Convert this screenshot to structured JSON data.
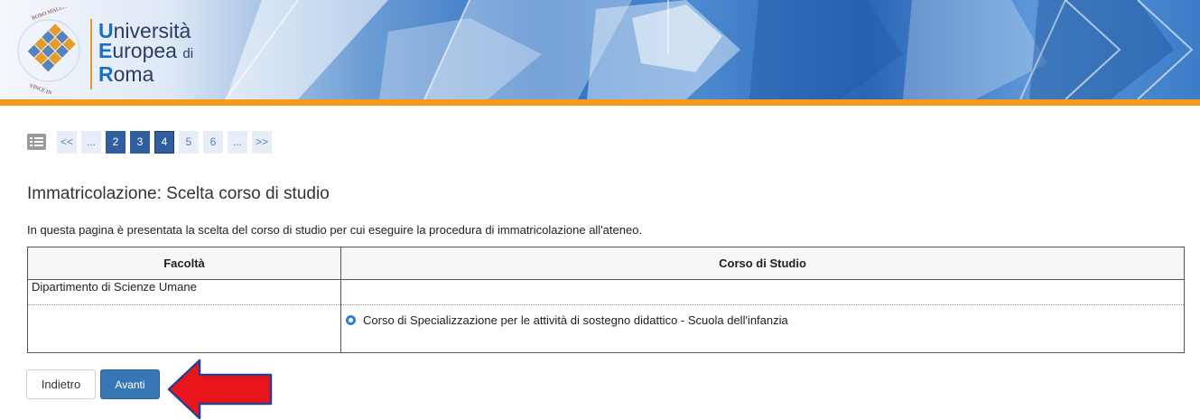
{
  "header": {
    "logo": {
      "line1_cap": "U",
      "line1_rest": "niversità",
      "line2_cap": "E",
      "line2_rest": "uropea",
      "line2_di": "di",
      "line3_cap": "R",
      "line3_rest": "oma",
      "seal_text": "VINCE IN BONO MALUM"
    },
    "colors": {
      "accent_bar": "#f39a1b",
      "brand_blue": "#2f5f9d"
    }
  },
  "pager": {
    "list_icon": "list-icon",
    "items": [
      {
        "label": "<<",
        "state": "light"
      },
      {
        "label": "...",
        "state": "light"
      },
      {
        "label": "2",
        "state": "dark"
      },
      {
        "label": "3",
        "state": "dark"
      },
      {
        "label": "4",
        "state": "current"
      },
      {
        "label": "5",
        "state": "light"
      },
      {
        "label": "6",
        "state": "light"
      },
      {
        "label": "...",
        "state": "light"
      },
      {
        "label": ">>",
        "state": "light"
      }
    ]
  },
  "page": {
    "title": "Immatricolazione: Scelta corso di studio",
    "intro": "In questa pagina è presentata la scelta del corso di studio per cui eseguire la procedura di immatricolazione all'ateneo."
  },
  "table": {
    "headers": [
      "Facoltà",
      "Corso di Studio"
    ],
    "department": "Dipartimento di Scienze Umane",
    "course_option": "Corso di Specializzazione per le attività di sostegno didattico - Scuola dell'infanzia"
  },
  "buttons": {
    "back": "Indietro",
    "next": "Avanti"
  }
}
